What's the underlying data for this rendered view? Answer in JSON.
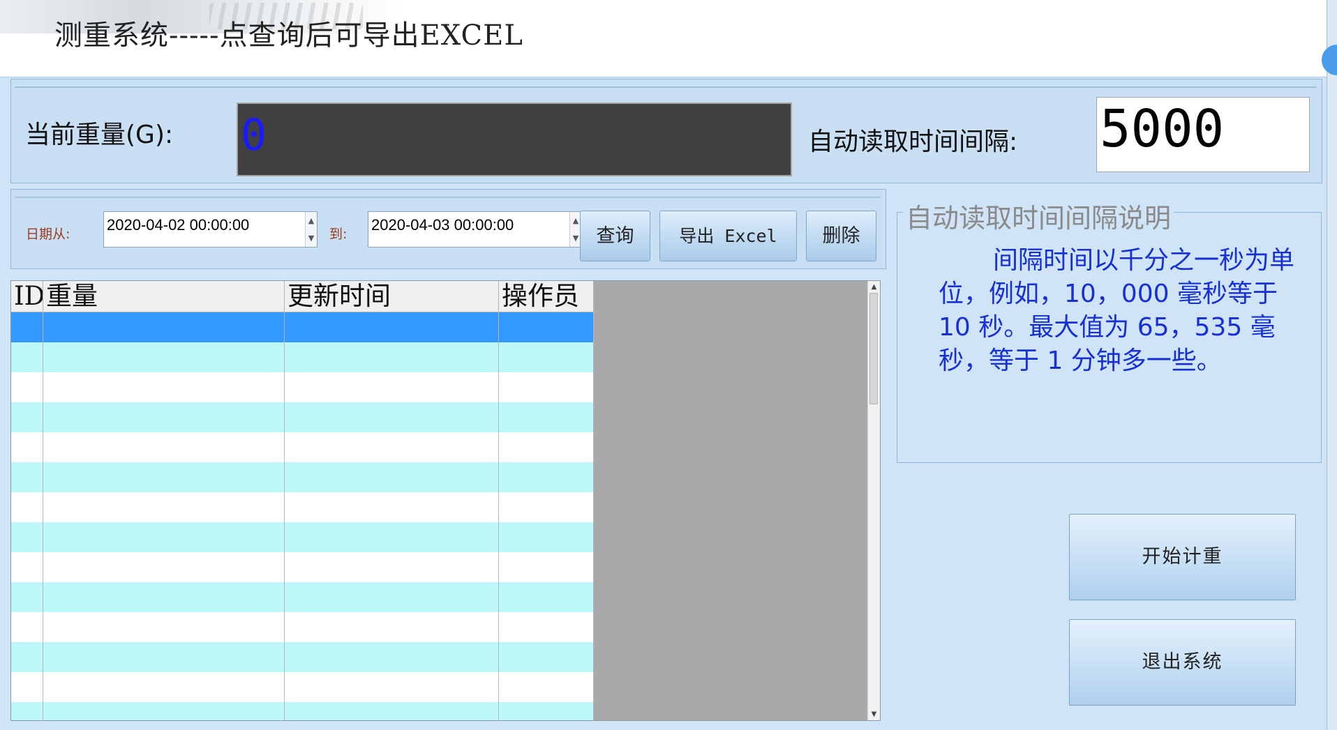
{
  "header": {
    "title": "测重系统-----点查询后可导出EXCEL"
  },
  "weight_panel": {
    "label": "当前重量(G):",
    "value": "0",
    "interval_label": "自动读取时间间隔:",
    "interval_value": "5000"
  },
  "query": {
    "from_label": "日期从:",
    "from_value": "2020-04-02 00:00:00",
    "to_label": "到:",
    "to_value": "2020-04-03 00:00:00",
    "query_button": "查询",
    "export_button": "导出 Excel",
    "delete_button": "删除"
  },
  "grid": {
    "columns": [
      "ID",
      "重量",
      "更新时间",
      "操作员"
    ],
    "rows": [
      {
        "id": "",
        "weight": "",
        "time": "",
        "operator": ""
      },
      {
        "id": "",
        "weight": "",
        "time": "",
        "operator": ""
      },
      {
        "id": "",
        "weight": "",
        "time": "",
        "operator": ""
      },
      {
        "id": "",
        "weight": "",
        "time": "",
        "operator": ""
      },
      {
        "id": "",
        "weight": "",
        "time": "",
        "operator": ""
      },
      {
        "id": "",
        "weight": "",
        "time": "",
        "operator": ""
      },
      {
        "id": "",
        "weight": "",
        "time": "",
        "operator": ""
      },
      {
        "id": "",
        "weight": "",
        "time": "",
        "operator": ""
      },
      {
        "id": "",
        "weight": "",
        "time": "",
        "operator": ""
      },
      {
        "id": "",
        "weight": "",
        "time": "",
        "operator": ""
      },
      {
        "id": "",
        "weight": "",
        "time": "",
        "operator": ""
      },
      {
        "id": "",
        "weight": "",
        "time": "",
        "operator": ""
      },
      {
        "id": "",
        "weight": "",
        "time": "",
        "operator": ""
      },
      {
        "id": "",
        "weight": "",
        "time": "",
        "operator": ""
      }
    ],
    "selected_row": 0
  },
  "info": {
    "title": "自动读取时间间隔说明",
    "text": "间隔时间以千分之一秒为单位，例如，10，000 毫秒等于 10 秒。最大值为 65，535 毫秒，等于 1 分钟多一些。"
  },
  "actions": {
    "start_button": "开始计重",
    "exit_button": "退出系统"
  },
  "colors": {
    "background": "#cfe4f6",
    "display_bg": "#404040",
    "display_digit": "#1a1aff",
    "row_alt": "#bdf7fa",
    "row_selected": "#3399ff",
    "info_text": "#1730d6"
  }
}
